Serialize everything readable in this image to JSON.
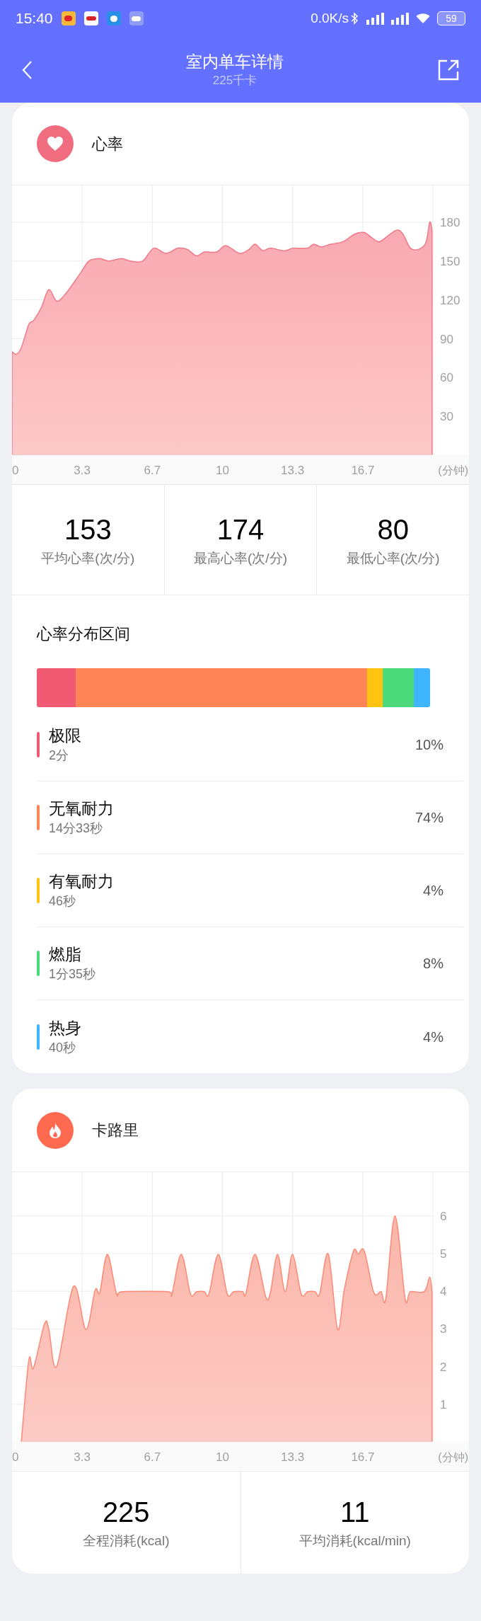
{
  "status_bar": {
    "time": "15:40",
    "net_speed": "0.0K/s",
    "battery": "59"
  },
  "header": {
    "title": "室内单车详情",
    "subtitle": "225千卡"
  },
  "heart_rate": {
    "title": "心率",
    "chart_data": {
      "type": "area",
      "xlabel": "(分钟)",
      "xlim": [
        0,
        20
      ],
      "ylim": [
        0,
        209
      ],
      "x": [
        0,
        0.22,
        0.44,
        0.8,
        1.02,
        1.39,
        1.75,
        2.12,
        2.56,
        3.22,
        3.65,
        4.17,
        4.6,
        5.19,
        5.63,
        6.21,
        6.73,
        7.31,
        7.89,
        8.33,
        8.77,
        9.14,
        9.72,
        10.16,
        10.8,
        11.26,
        11.55,
        11.92,
        12.28,
        12.94,
        13.37,
        14.04,
        14.33,
        14.69,
        15.13,
        15.72,
        16.3,
        16.74,
        17.1,
        17.46,
        17.9,
        18.3,
        18.57,
        18.93,
        19.3,
        19.66,
        19.85,
        19.96
      ],
      "series": [
        {
          "color": "#f07a88",
          "values": [
            80,
            78,
            83,
            101,
            104,
            114,
            128,
            119,
            125,
            140,
            150,
            152,
            150,
            152,
            150,
            150,
            160,
            156,
            160,
            159,
            154,
            157,
            157,
            162,
            156,
            159,
            163,
            158,
            160,
            158,
            160,
            160,
            163,
            161,
            163,
            165,
            171,
            172,
            168,
            165,
            170,
            174,
            171,
            160,
            159,
            164,
            180,
            174
          ]
        }
      ],
      "xticks": [
        {
          "value": 0,
          "label": "0"
        },
        {
          "value": 3.33,
          "label": "3.3"
        },
        {
          "value": 6.67,
          "label": "6.7"
        },
        {
          "value": 10,
          "label": "10"
        },
        {
          "value": 13.33,
          "label": "13.3"
        },
        {
          "value": 16.67,
          "label": "16.7"
        }
      ],
      "yticks": [
        30,
        60,
        90,
        120,
        150,
        180
      ],
      "grid": true
    },
    "stats": [
      {
        "value": "153",
        "label": "平均心率(次/分)"
      },
      {
        "value": "174",
        "label": "最高心率(次/分)"
      },
      {
        "value": "80",
        "label": "最低心率(次/分)"
      }
    ]
  },
  "zones": {
    "title": "心率分布区间",
    "items": [
      {
        "name": "极限",
        "duration": "2分",
        "percent": "10%",
        "color": "#f05a72"
      },
      {
        "name": "无氧耐力",
        "duration": "14分33秒",
        "percent": "74%",
        "color": "#ff8559"
      },
      {
        "name": "有氧耐力",
        "duration": "46秒",
        "percent": "4%",
        "color": "#ffc312"
      },
      {
        "name": "燃脂",
        "duration": "1分35秒",
        "percent": "8%",
        "color": "#4cd97b"
      },
      {
        "name": "热身",
        "duration": "40秒",
        "percent": "4%",
        "color": "#3fb4ff"
      }
    ]
  },
  "calories": {
    "title": "卡路里",
    "chart_data": {
      "type": "area",
      "xlabel": "(分钟)",
      "xlim": [
        0,
        20
      ],
      "ylim": [
        0,
        7.18
      ],
      "x": [
        0.44,
        0.8,
        1.02,
        1.54,
        1.75,
        2.12,
        2.92,
        3.51,
        3.95,
        4.17,
        4.53,
        4.97,
        5.26,
        7.38,
        7.6,
        8.04,
        8.48,
        8.77,
        9.14,
        9.36,
        9.8,
        10.23,
        10.53,
        10.96,
        11.11,
        11.55,
        12.06,
        12.28,
        12.62,
        12.98,
        13.33,
        13.74,
        14.04,
        14.4,
        14.62,
        15.03,
        15.47,
        15.79,
        16.23,
        16.45,
        16.74,
        17.19,
        17.54,
        17.76,
        18.2,
        18.68,
        18.93,
        19.59,
        19.85,
        19.96
      ],
      "series": [
        {
          "color": "#fa8a76",
          "values": [
            0,
            2.17,
            1.96,
            3.13,
            2.99,
            2.0,
            4.13,
            2.99,
            4.03,
            3.97,
            4.98,
            3.93,
            3.99,
            3.99,
            3.93,
            4.98,
            3.93,
            3.99,
            3.99,
            3.93,
            4.98,
            3.93,
            3.99,
            3.99,
            3.93,
            4.98,
            3.85,
            3.97,
            4.98,
            3.99,
            4.98,
            3.93,
            3.99,
            3.99,
            3.93,
            4.99,
            2.99,
            4.05,
            5.07,
            4.99,
            5.07,
            3.97,
            3.99,
            3.81,
            6.0,
            3.81,
            3.99,
            3.99,
            4.38,
            3.97
          ]
        }
      ],
      "xticks": [
        {
          "value": 0,
          "label": "0"
        },
        {
          "value": 3.33,
          "label": "3.3"
        },
        {
          "value": 6.67,
          "label": "6.7"
        },
        {
          "value": 10,
          "label": "10"
        },
        {
          "value": 13.33,
          "label": "13.3"
        },
        {
          "value": 16.67,
          "label": "16.7"
        }
      ],
      "yticks": [
        1,
        2,
        3,
        4,
        5,
        6
      ],
      "grid": true
    },
    "stats": [
      {
        "value": "225",
        "label": "全程消耗(kcal)"
      },
      {
        "value": "11",
        "label": "平均消耗(kcal/min)"
      }
    ]
  }
}
